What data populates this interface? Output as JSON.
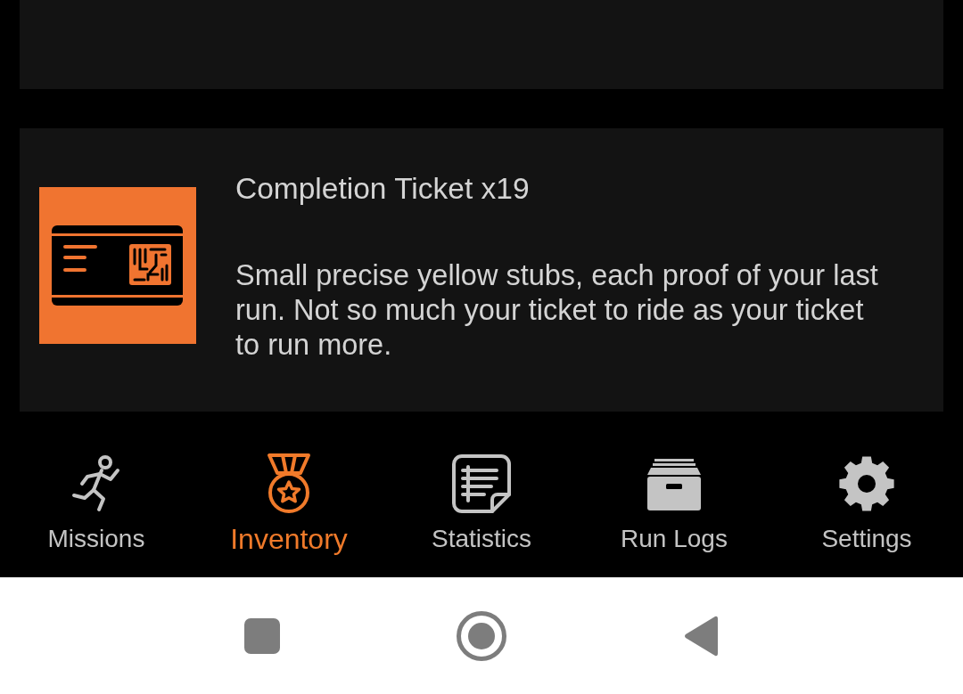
{
  "items": [
    {
      "title": "Completion Ticket x19",
      "description": "Small precise yellow stubs, each proof of your last run. Not so much your ticket to ride as your ticket to run more."
    }
  ],
  "bottom_nav": [
    {
      "label": "Missions",
      "selected": false
    },
    {
      "label": "Inventory",
      "selected": true
    },
    {
      "label": "Statistics",
      "selected": false
    },
    {
      "label": "Run Logs",
      "selected": false
    },
    {
      "label": "Settings",
      "selected": false
    }
  ]
}
